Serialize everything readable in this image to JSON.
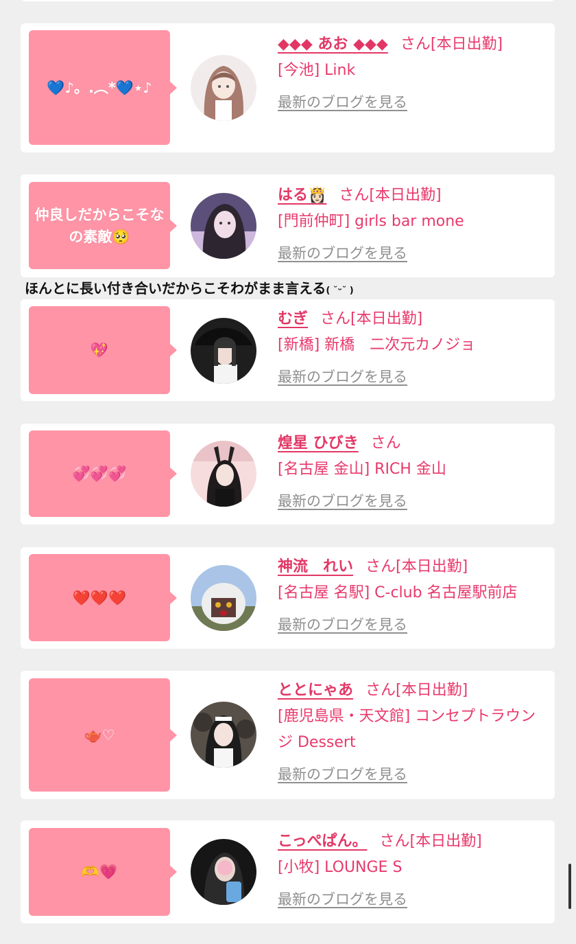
{
  "overlay_caption": "ほんとに長い付き合いだからこそわがまま言える",
  "overlay_kaomoji": "( ˘ᵕ˘ )",
  "san_label": "さん",
  "blog_link_label": "最新のブログを見る",
  "cards": [
    {
      "bubble_text": "💙♪。.︵*💙⋆♪",
      "name": "◆◆◆ あお ◆◆◆",
      "attendance": "[本日出勤]",
      "shop": "[今池] Link"
    },
    {
      "bubble_text": "仲良しだからこそなの素敵🥺",
      "name": "はる👸🏻",
      "attendance": "[本日出勤]",
      "shop": "[門前仲町] girls bar mone"
    },
    {
      "bubble_text": "💖",
      "name": "むぎ",
      "attendance": "[本日出勤]",
      "shop": "[新橋] 新橋　二次元カノジョ"
    },
    {
      "bubble_text": "💞💞💞",
      "name": "煌星 ひびき",
      "attendance": "",
      "shop": "[名古屋 金山] RICH 金山"
    },
    {
      "bubble_text": "❤️❤️❤️",
      "name": "神流　れい",
      "attendance": "[本日出勤]",
      "shop": "[名古屋 名駅] C-club 名古屋駅前店"
    },
    {
      "bubble_text": "🫖♡",
      "name": "ととにゃあ",
      "attendance": "[本日出勤]",
      "shop": "[鹿児島県・天文館] コンセプトラウンジ Dessert"
    },
    {
      "bubble_text": "🫶💗",
      "name": "こっぺぱん。",
      "attendance": "[本日出勤]",
      "shop": "[小牧] LOUNGE S"
    }
  ]
}
